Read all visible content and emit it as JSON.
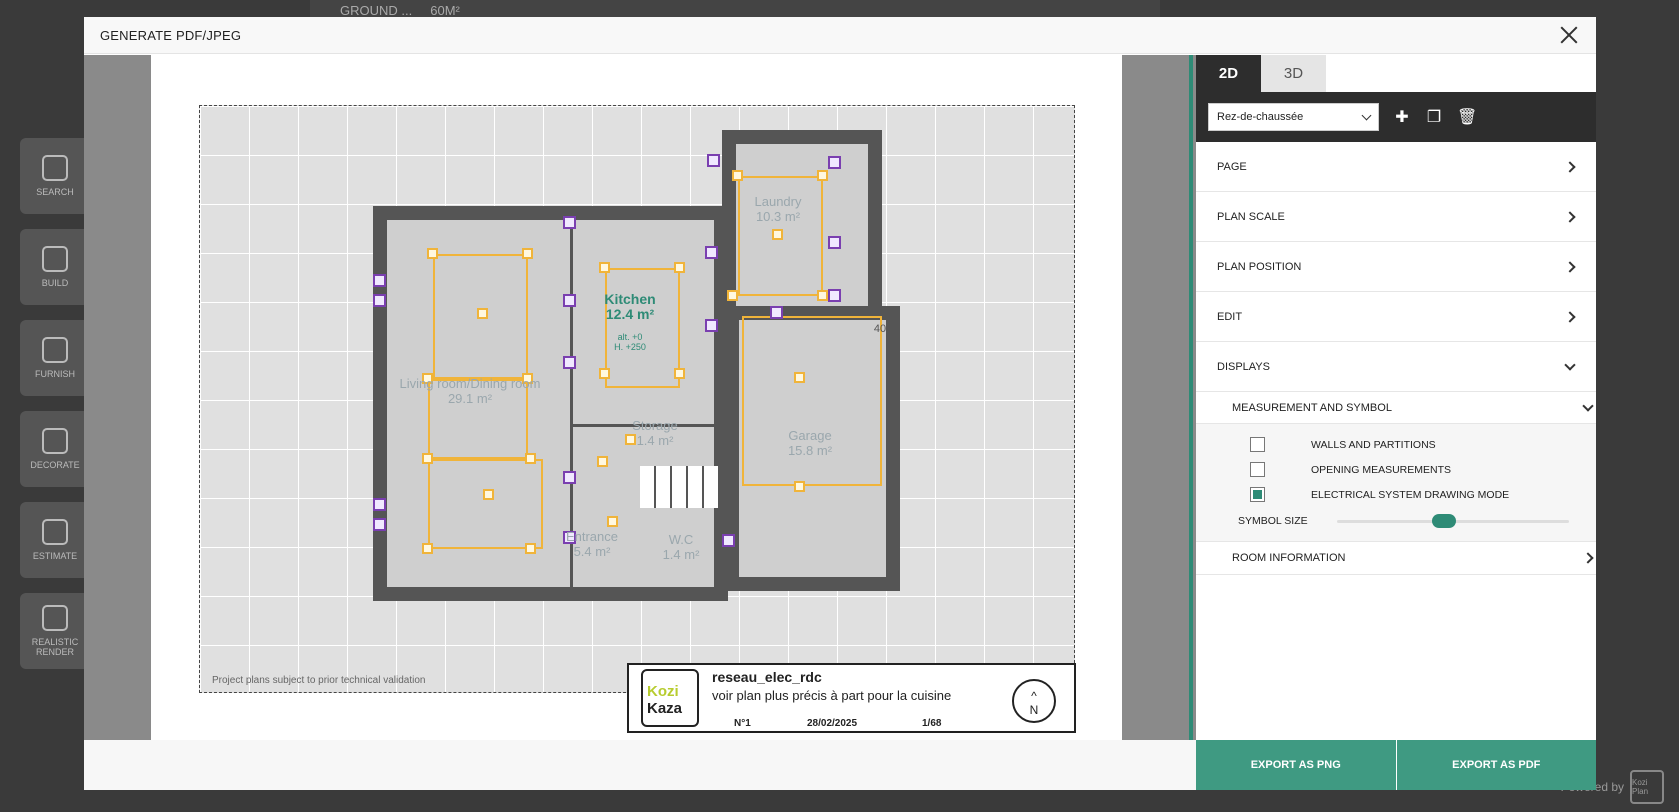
{
  "background": {
    "toolbar_floor": "GROUND ...",
    "toolbar_area": "60M²",
    "sidebar": [
      {
        "label": "SEARCH"
      },
      {
        "label": "BUILD"
      },
      {
        "label": "FURNISH"
      },
      {
        "label": "DECORATE"
      },
      {
        "label": "ESTIMATE"
      },
      {
        "label": "REALISTIC RENDER"
      }
    ],
    "powered_by": "Powered by",
    "powered_logo": "Kozi Plan"
  },
  "modal": {
    "title": "GENERATE PDF/JPEG"
  },
  "preview": {
    "rooms": [
      {
        "name": "Laundry",
        "area": "10.3 m²"
      },
      {
        "name": "Kitchen",
        "area": "12.4 m²"
      },
      {
        "name": "Living room/Dining room",
        "area": "29.1 m²"
      },
      {
        "name": "Storage",
        "area": "1.4 m²"
      },
      {
        "name": "Garage",
        "area": "15.8 m²"
      },
      {
        "name": "Entrance",
        "area": "5.4 m²"
      },
      {
        "name": "W.C",
        "area": "1.4 m²"
      }
    ],
    "kitchen_note_1": "alt. +0",
    "kitchen_note_2": "H. +250",
    "dimension_label": "40",
    "disclaimer": "Project plans subject to prior technical validation",
    "title_block": {
      "logo_line1": "Kozi",
      "logo_line2": "Kaza",
      "name": "reseau_elec_rdc",
      "description": "voir plan plus précis à part pour la cuisine",
      "number": "N°1",
      "date": "28/02/2025",
      "scale": "1/68",
      "north": "N"
    }
  },
  "panel": {
    "tabs": [
      {
        "label": "2D"
      },
      {
        "label": "3D"
      }
    ],
    "floor_select": "Rez-de-chaussée",
    "sections": {
      "page": "PAGE",
      "plan_scale": "PLAN SCALE",
      "plan_position": "PLAN POSITION",
      "edit": "EDIT",
      "displays": "DISPLAYS",
      "measurement_symbol": "MEASUREMENT AND SYMBOL",
      "room_information": "ROOM INFORMATION"
    },
    "options": [
      {
        "label": "WALLS AND PARTITIONS",
        "checked": false
      },
      {
        "label": "OPENING MEASUREMENTS",
        "checked": false
      },
      {
        "label": "ELECTRICAL SYSTEM DRAWING MODE",
        "checked": true
      }
    ],
    "symbol_size_label": "SYMBOL SIZE",
    "symbol_size_value": 0.46,
    "export_png": "EXPORT AS PNG",
    "export_pdf": "EXPORT AS PDF"
  },
  "colors": {
    "accent": "#2e8b76",
    "export": "#3f9a82",
    "electrical_line": "#f0b43a",
    "electrical_outlet": "#7a3fb0"
  }
}
